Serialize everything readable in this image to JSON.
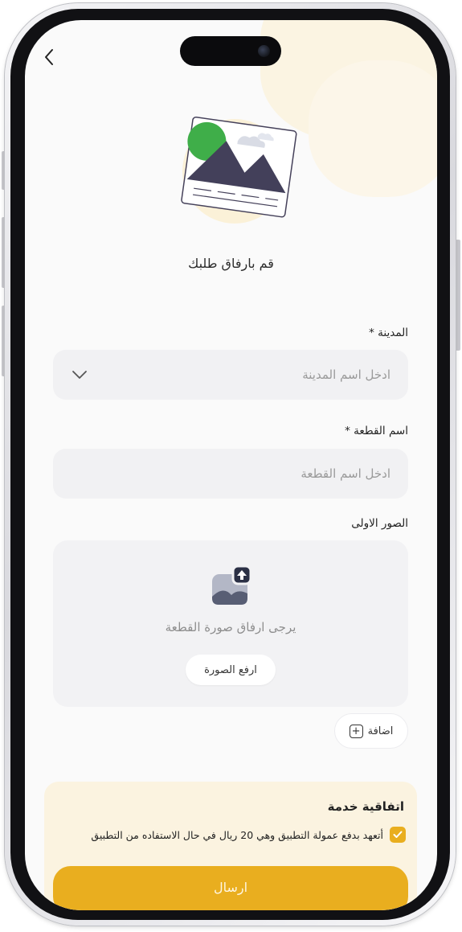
{
  "header": {
    "back_icon": "chevron-left-icon",
    "illustration_icon": "image-placeholder-illustration"
  },
  "headline": "قم بارفاق طلبك",
  "city": {
    "label": "المدينة *",
    "placeholder": "ادخل اسم المدينة",
    "dropdown_icon": "chevron-down-icon"
  },
  "part_name": {
    "label": "اسم القطعة *",
    "placeholder": "ادخل اسم القطعة"
  },
  "images": {
    "label": "الصور الاولى",
    "upload_icon": "image-upload-icon",
    "hint": "يرجى ارفاق صورة القطعة",
    "upload_button": "ارفع الصورة"
  },
  "add_button": {
    "label": "اضافة",
    "icon": "plus-box-icon"
  },
  "agreement": {
    "title": "اتفاقية خدمة",
    "text": "أتعهد بدفع عمولة التطبيق وهي 20 ريال في حال الاستفاده من التطبيق",
    "checked": true
  },
  "submit": {
    "label": "ارسال"
  },
  "colors": {
    "accent": "#E9AE1F",
    "agreement_bg": "#FBF3E0",
    "field_bg": "#F1F1F3"
  }
}
